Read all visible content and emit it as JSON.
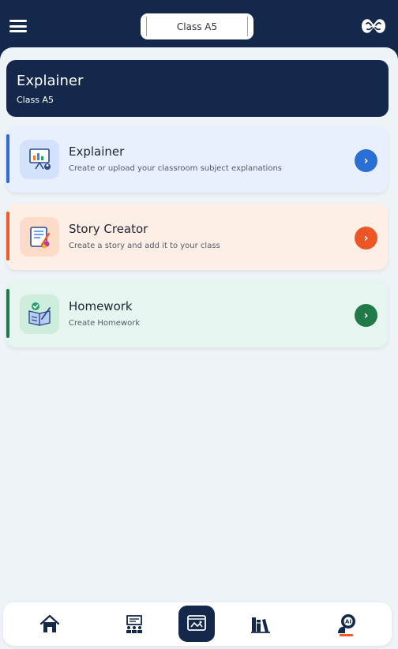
{
  "header": {
    "class_selector": "Class A5",
    "menu_icon": "hamburger-menu-icon",
    "logo_icon": "brand-logo-icon"
  },
  "banner": {
    "title": "Explainer",
    "subtitle": "Class A5"
  },
  "cards": [
    {
      "title": "Explainer",
      "description": "Create or upload your classroom subject explanations",
      "icon": "presentation-board-icon",
      "accent": "#2f6bd6"
    },
    {
      "title": "Story Creator",
      "description": "Create a story and add it to your class",
      "icon": "story-notebook-icon",
      "accent": "#eb5a27"
    },
    {
      "title": "Homework",
      "description": "Create Homework",
      "icon": "homework-book-icon",
      "accent": "#21794b"
    }
  ],
  "bottom_nav": {
    "items": [
      "home-icon",
      "classroom-icon",
      "creator-icon",
      "library-icon",
      "ai-assistant-icon"
    ],
    "active": "creator-icon"
  },
  "colors": {
    "primary": "#13284a",
    "background": "#eef3f8",
    "active_underline": "#ef5a2a"
  }
}
